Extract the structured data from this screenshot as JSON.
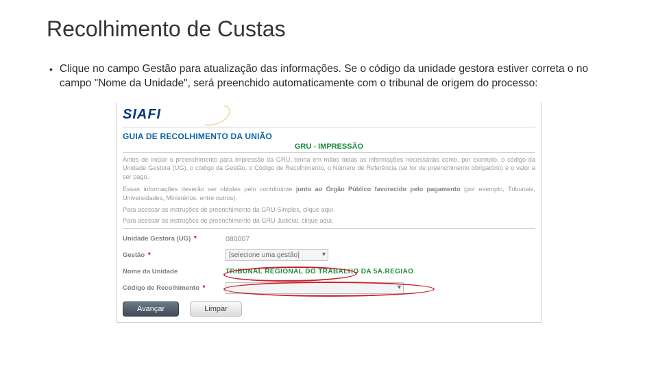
{
  "title": "Recolhimento de Custas",
  "bullet": "Clique no campo Gestão para atualização das informações. Se o código da unidade gestora estiver correta o no campo \"Nome da Unidade\", será preenchido automaticamente com o tribunal  de origem do processo:",
  "siafi": {
    "logo": "SIAFI",
    "guia": "GUIA DE RECOLHIMENTO DA UNIÃO",
    "gru": "GRU - IMPRESSÃO",
    "intro1_a": "Antes de iniciar o preenchimento para impressão da GRU, tenha em mãos todas as informações necessárias como, por exemplo, o código da Unidade Gestora (UG), o código da Gestão, o Código de Recolhimento, o Número de Referência (se for de preenchimento obrigatório) e o valor a ser pago.",
    "intro2_a": "Essas informações deverão ser obtidas pelo contribuinte ",
    "intro2_b": "junto ao Órgão Público favorecido pelo pagamento",
    "intro2_c": " (por exemplo, Tribunais, Universidades, Ministérios, entre outros).",
    "access1": "Para acessar as instruções de preenchimento da GRU Simples, clique aqui.",
    "access2": "Para acessar as instruções de preenchimento da GRU Judicial, clique aqui.",
    "labels": {
      "ug": "Unidade Gestora (UG)",
      "gestao": "Gestão",
      "nome": "Nome da Unidade",
      "codigo": "Código de Recolhimento"
    },
    "values": {
      "ug": "080007",
      "gestao": "[selecione uma gestão]",
      "nome": "TRIBUNAL REGIONAL DO TRABALHO DA 5A.REGIAO",
      "codigo": ""
    },
    "buttons": {
      "avancar": "Avançar",
      "limpar": "Limpar"
    }
  }
}
